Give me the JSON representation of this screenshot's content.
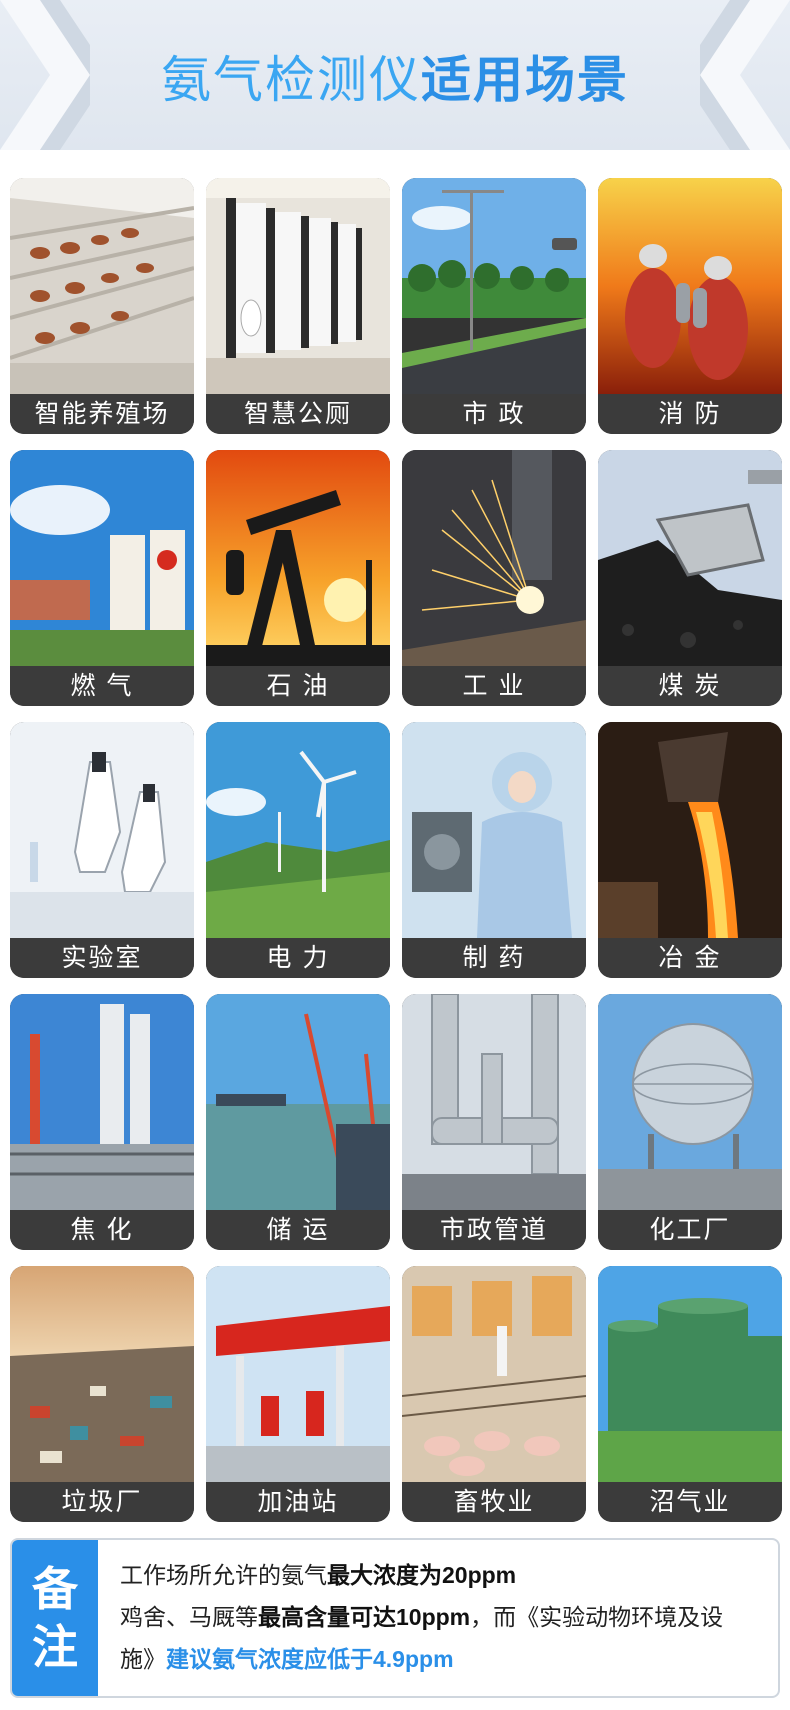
{
  "header": {
    "title_part1": "氨气检测仪",
    "title_part2": "适用场景",
    "title_color1": "#3aa6f2",
    "title_color2": "#2b8fe6"
  },
  "tiles": [
    {
      "label": "智能养殖场",
      "photo": "poultry-cage-photo"
    },
    {
      "label": "智慧公厕",
      "photo": "public-toilet-photo"
    },
    {
      "label": "市 政",
      "photo": "street-lamp-road-photo"
    },
    {
      "label": "消 防",
      "photo": "firefighters-photo"
    },
    {
      "label": "燃 气",
      "photo": "gas-storage-tanks-photo"
    },
    {
      "label": "石 油",
      "photo": "oil-pumpjack-sunset-photo"
    },
    {
      "label": "工 业",
      "photo": "welding-sparks-photo"
    },
    {
      "label": "煤 炭",
      "photo": "coal-excavator-photo"
    },
    {
      "label": "实验室",
      "photo": "microscope-lab-photo"
    },
    {
      "label": "电 力",
      "photo": "wind-turbine-photo"
    },
    {
      "label": "制 药",
      "photo": "pharma-worker-photo"
    },
    {
      "label": "冶 金",
      "photo": "molten-steel-photo"
    },
    {
      "label": "焦 化",
      "photo": "coking-plant-photo"
    },
    {
      "label": "储 运",
      "photo": "container-port-photo"
    },
    {
      "label": "市政管道",
      "photo": "industrial-pipes-photo"
    },
    {
      "label": "化工厂",
      "photo": "spherical-tank-photo"
    },
    {
      "label": "垃圾厂",
      "photo": "landfill-waste-photo"
    },
    {
      "label": "加油站",
      "photo": "gas-station-photo"
    },
    {
      "label": "畜牧业",
      "photo": "pig-farm-photo"
    },
    {
      "label": "沼气业",
      "photo": "biogas-tanks-photo"
    }
  ],
  "note": {
    "side_char1": "备",
    "side_char2": "注",
    "line1_a": "工作场所允许的氨气",
    "line1_b": "最大浓度为20ppm",
    "line2_a": "鸡舍、马厩等",
    "line2_b": "最高含量可达10ppm",
    "line2_c": "，而《实验动物环境及设",
    "line3_a": "施》",
    "line3_b": "建议氨气浓度应低于4.9ppm",
    "accent_color": "#2a8fe8"
  }
}
